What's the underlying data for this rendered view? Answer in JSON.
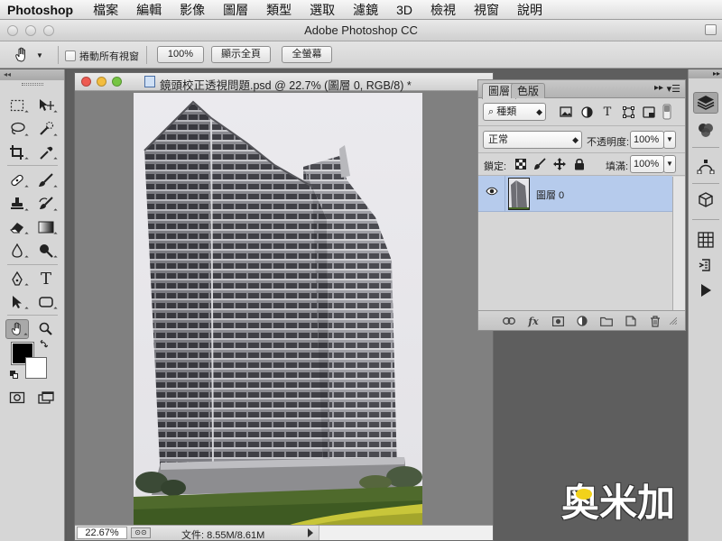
{
  "menubar": {
    "app_name": "Photoshop",
    "items": [
      "檔案",
      "編輯",
      "影像",
      "圖層",
      "類型",
      "選取",
      "濾鏡",
      "3D",
      "檢視",
      "視窗",
      "說明"
    ]
  },
  "window": {
    "title": "Adobe Photoshop CC"
  },
  "options_bar": {
    "scroll_all_label": "捲動所有視窗",
    "zoom_button": "100%",
    "fit_screen_button": "顯示全頁",
    "fill_screen_button": "全螢幕"
  },
  "toolbox": {
    "head_label": "◂◂",
    "tools": [
      "rect-marquee",
      "move",
      "lasso",
      "quick-selection",
      "crop",
      "eyedropper",
      "spot-healing",
      "brush",
      "clone-stamp",
      "history-brush",
      "eraser",
      "gradient",
      "blur",
      "dodge",
      "pen",
      "type",
      "path-selection",
      "rectangle-shape",
      "hand",
      "zoom"
    ],
    "type_tool_glyph": "T"
  },
  "document": {
    "title": "鏡頭校正透視問題.psd @ 22.7% (圖層 0, RGB/8) *",
    "status_zoom": "22.67%",
    "doc_size": "文件: 8.55M/8.61M"
  },
  "layers_panel": {
    "tabs": [
      "圖層",
      "色版"
    ],
    "kind_filter": "種類",
    "filter_type_glyph": "T",
    "blend_mode": "正常",
    "opacity_label": "不透明度:",
    "opacity_value": "100%",
    "lock_label": "鎖定:",
    "fill_label": "填滿:",
    "fill_value": "100%",
    "layers": [
      {
        "name": "圖層 0",
        "visible": true,
        "selected": true
      }
    ],
    "footer_fx": "fx"
  },
  "right_dock": {
    "icons": [
      "layers-panel-icon",
      "channels-icon",
      "paths-icon",
      "3d-icon",
      "swatches-icon",
      "history-icon",
      "actions-play-icon"
    ]
  },
  "watermark": {
    "text": "奥米加"
  },
  "colors": {
    "foreground": "#000000",
    "background": "#ffffff",
    "selected_layer": "#b6cbec",
    "close_light": "#ee5b52",
    "minimize_light": "#f3bd3f",
    "zoom_light": "#76c543"
  }
}
